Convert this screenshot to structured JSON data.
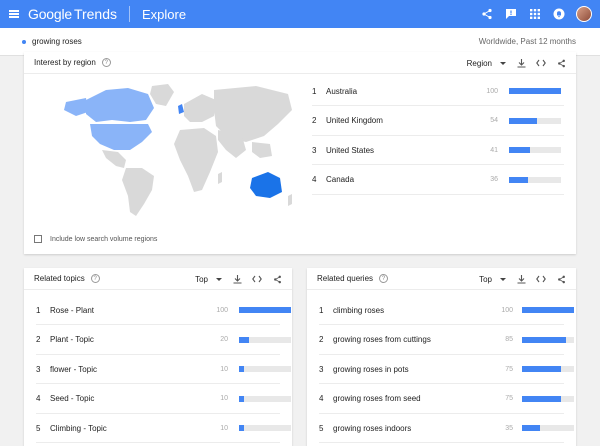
{
  "header": {
    "brand": "Google",
    "product": "Trends",
    "section": "Explore"
  },
  "search": {
    "term": "growing roses",
    "scope": "Worldwide, Past 12 months",
    "term_color": "#4285f4"
  },
  "region_card": {
    "title": "Interest by region",
    "selector": "Region",
    "checkbox_label": "Include low search volume regions",
    "rows": [
      {
        "rank": "1",
        "label": "Australia",
        "value": "100",
        "pct": 100
      },
      {
        "rank": "2",
        "label": "United Kingdom",
        "value": "54",
        "pct": 54
      },
      {
        "rank": "3",
        "label": "United States",
        "value": "41",
        "pct": 41
      },
      {
        "rank": "4",
        "label": "Canada",
        "value": "36",
        "pct": 36
      }
    ]
  },
  "topics_card": {
    "title": "Related topics",
    "selector": "Top",
    "rows": [
      {
        "rank": "1",
        "label": "Rose - Plant",
        "value": "100",
        "pct": 100
      },
      {
        "rank": "2",
        "label": "Plant - Topic",
        "value": "20",
        "pct": 20
      },
      {
        "rank": "3",
        "label": "flower - Topic",
        "value": "10",
        "pct": 10
      },
      {
        "rank": "4",
        "label": "Seed - Topic",
        "value": "10",
        "pct": 10
      },
      {
        "rank": "5",
        "label": "Climbing - Topic",
        "value": "10",
        "pct": 10
      }
    ]
  },
  "queries_card": {
    "title": "Related queries",
    "selector": "Top",
    "rows": [
      {
        "rank": "1",
        "label": "climbing roses",
        "value": "100",
        "pct": 100
      },
      {
        "rank": "2",
        "label": "growing roses from cuttings",
        "value": "85",
        "pct": 85
      },
      {
        "rank": "3",
        "label": "growing roses in pots",
        "value": "75",
        "pct": 75
      },
      {
        "rank": "4",
        "label": "growing roses from seed",
        "value": "75",
        "pct": 75
      },
      {
        "rank": "5",
        "label": "growing roses indoors",
        "value": "35",
        "pct": 35
      }
    ]
  },
  "colors": {
    "accent": "#4285f4",
    "map_dark": "#1a73e8",
    "map_light": "#8ab4f8",
    "map_none": "#d9d9d9"
  }
}
